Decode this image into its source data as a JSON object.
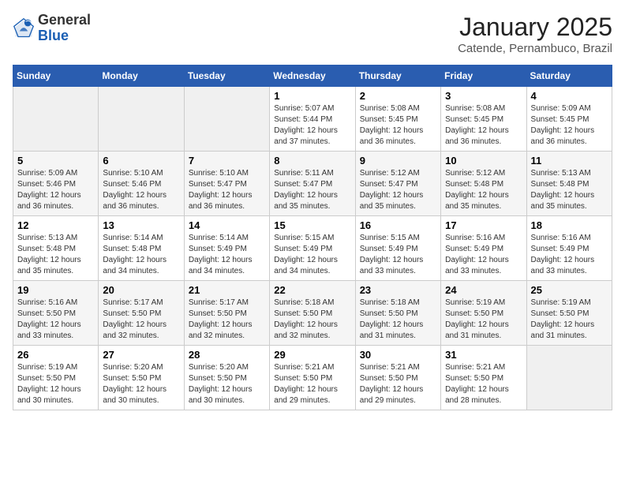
{
  "header": {
    "logo_general": "General",
    "logo_blue": "Blue",
    "month_title": "January 2025",
    "subtitle": "Catende, Pernambuco, Brazil"
  },
  "weekdays": [
    "Sunday",
    "Monday",
    "Tuesday",
    "Wednesday",
    "Thursday",
    "Friday",
    "Saturday"
  ],
  "weeks": [
    [
      {
        "day": "",
        "info": ""
      },
      {
        "day": "",
        "info": ""
      },
      {
        "day": "",
        "info": ""
      },
      {
        "day": "1",
        "info": "Sunrise: 5:07 AM\nSunset: 5:44 PM\nDaylight: 12 hours\nand 37 minutes."
      },
      {
        "day": "2",
        "info": "Sunrise: 5:08 AM\nSunset: 5:45 PM\nDaylight: 12 hours\nand 36 minutes."
      },
      {
        "day": "3",
        "info": "Sunrise: 5:08 AM\nSunset: 5:45 PM\nDaylight: 12 hours\nand 36 minutes."
      },
      {
        "day": "4",
        "info": "Sunrise: 5:09 AM\nSunset: 5:45 PM\nDaylight: 12 hours\nand 36 minutes."
      }
    ],
    [
      {
        "day": "5",
        "info": "Sunrise: 5:09 AM\nSunset: 5:46 PM\nDaylight: 12 hours\nand 36 minutes."
      },
      {
        "day": "6",
        "info": "Sunrise: 5:10 AM\nSunset: 5:46 PM\nDaylight: 12 hours\nand 36 minutes."
      },
      {
        "day": "7",
        "info": "Sunrise: 5:10 AM\nSunset: 5:47 PM\nDaylight: 12 hours\nand 36 minutes."
      },
      {
        "day": "8",
        "info": "Sunrise: 5:11 AM\nSunset: 5:47 PM\nDaylight: 12 hours\nand 35 minutes."
      },
      {
        "day": "9",
        "info": "Sunrise: 5:12 AM\nSunset: 5:47 PM\nDaylight: 12 hours\nand 35 minutes."
      },
      {
        "day": "10",
        "info": "Sunrise: 5:12 AM\nSunset: 5:48 PM\nDaylight: 12 hours\nand 35 minutes."
      },
      {
        "day": "11",
        "info": "Sunrise: 5:13 AM\nSunset: 5:48 PM\nDaylight: 12 hours\nand 35 minutes."
      }
    ],
    [
      {
        "day": "12",
        "info": "Sunrise: 5:13 AM\nSunset: 5:48 PM\nDaylight: 12 hours\nand 35 minutes."
      },
      {
        "day": "13",
        "info": "Sunrise: 5:14 AM\nSunset: 5:48 PM\nDaylight: 12 hours\nand 34 minutes."
      },
      {
        "day": "14",
        "info": "Sunrise: 5:14 AM\nSunset: 5:49 PM\nDaylight: 12 hours\nand 34 minutes."
      },
      {
        "day": "15",
        "info": "Sunrise: 5:15 AM\nSunset: 5:49 PM\nDaylight: 12 hours\nand 34 minutes."
      },
      {
        "day": "16",
        "info": "Sunrise: 5:15 AM\nSunset: 5:49 PM\nDaylight: 12 hours\nand 33 minutes."
      },
      {
        "day": "17",
        "info": "Sunrise: 5:16 AM\nSunset: 5:49 PM\nDaylight: 12 hours\nand 33 minutes."
      },
      {
        "day": "18",
        "info": "Sunrise: 5:16 AM\nSunset: 5:49 PM\nDaylight: 12 hours\nand 33 minutes."
      }
    ],
    [
      {
        "day": "19",
        "info": "Sunrise: 5:16 AM\nSunset: 5:50 PM\nDaylight: 12 hours\nand 33 minutes."
      },
      {
        "day": "20",
        "info": "Sunrise: 5:17 AM\nSunset: 5:50 PM\nDaylight: 12 hours\nand 32 minutes."
      },
      {
        "day": "21",
        "info": "Sunrise: 5:17 AM\nSunset: 5:50 PM\nDaylight: 12 hours\nand 32 minutes."
      },
      {
        "day": "22",
        "info": "Sunrise: 5:18 AM\nSunset: 5:50 PM\nDaylight: 12 hours\nand 32 minutes."
      },
      {
        "day": "23",
        "info": "Sunrise: 5:18 AM\nSunset: 5:50 PM\nDaylight: 12 hours\nand 31 minutes."
      },
      {
        "day": "24",
        "info": "Sunrise: 5:19 AM\nSunset: 5:50 PM\nDaylight: 12 hours\nand 31 minutes."
      },
      {
        "day": "25",
        "info": "Sunrise: 5:19 AM\nSunset: 5:50 PM\nDaylight: 12 hours\nand 31 minutes."
      }
    ],
    [
      {
        "day": "26",
        "info": "Sunrise: 5:19 AM\nSunset: 5:50 PM\nDaylight: 12 hours\nand 30 minutes."
      },
      {
        "day": "27",
        "info": "Sunrise: 5:20 AM\nSunset: 5:50 PM\nDaylight: 12 hours\nand 30 minutes."
      },
      {
        "day": "28",
        "info": "Sunrise: 5:20 AM\nSunset: 5:50 PM\nDaylight: 12 hours\nand 30 minutes."
      },
      {
        "day": "29",
        "info": "Sunrise: 5:21 AM\nSunset: 5:50 PM\nDaylight: 12 hours\nand 29 minutes."
      },
      {
        "day": "30",
        "info": "Sunrise: 5:21 AM\nSunset: 5:50 PM\nDaylight: 12 hours\nand 29 minutes."
      },
      {
        "day": "31",
        "info": "Sunrise: 5:21 AM\nSunset: 5:50 PM\nDaylight: 12 hours\nand 28 minutes."
      },
      {
        "day": "",
        "info": ""
      }
    ]
  ]
}
